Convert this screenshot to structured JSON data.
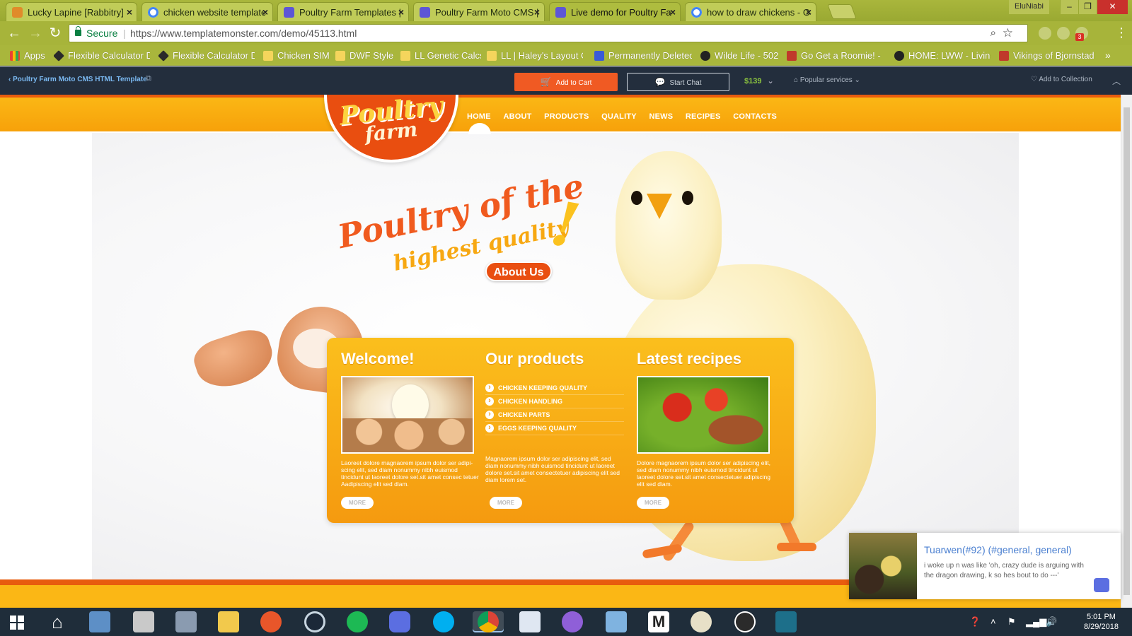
{
  "browser": {
    "tabs": [
      {
        "title": "Lucky Lapine [Rabbitry]",
        "icon": "rabbit-icon"
      },
      {
        "title": "chicken website template",
        "icon": "google-icon"
      },
      {
        "title": "Poultry Farm Templates |",
        "icon": "templatemonster-icon"
      },
      {
        "title": "Poultry Farm Moto CMS |",
        "icon": "templatemonster-icon"
      },
      {
        "title": "Live demo for Poultry Fa",
        "icon": "templatemonster-icon"
      },
      {
        "title": "how to draw chickens - G",
        "icon": "google-icon"
      }
    ],
    "active_tab": 4,
    "profile_name": "EluNiabi",
    "security_label": "Secure",
    "url": "https://www.templatemonster.com/demo/45113.html",
    "extension_badge": "3",
    "bookmarks": [
      {
        "label": "Apps",
        "icon": "apps-icon"
      },
      {
        "label": "Flexible Calculator D",
        "icon": "diamond-icon"
      },
      {
        "label": "Flexible Calculator D",
        "icon": "diamond-icon"
      },
      {
        "label": "Chicken SIM",
        "icon": "folder-icon"
      },
      {
        "label": "DWF Style",
        "icon": "folder-icon"
      },
      {
        "label": "LL Genetic Calcs",
        "icon": "folder-icon"
      },
      {
        "label": "LL | Haley's Layout C",
        "icon": "folder-icon"
      },
      {
        "label": "Permanently Deleted",
        "icon": "doc-icon"
      },
      {
        "label": "Wilde Life - 502",
        "icon": "paw-icon"
      },
      {
        "label": "Go Get a Roomie! -",
        "icon": "comic-icon"
      },
      {
        "label": "HOME: LWW - Living",
        "icon": "paw-icon"
      },
      {
        "label": "Vikings of Bjornstad",
        "icon": "shield-icon"
      }
    ]
  },
  "tm_bar": {
    "back_label": "Poultry Farm Moto CMS HTML Template",
    "add_to_cart": "Add to Cart",
    "start_chat": "Start Chat",
    "price": "$139",
    "popular_services": "Popular services",
    "add_to_collection": "Add to Collection"
  },
  "site": {
    "logo_line1": "Poultry",
    "logo_line2": "farm",
    "nav": [
      "HOME",
      "ABOUT",
      "PRODUCTS",
      "QUALITY",
      "NEWS",
      "RECIPES",
      "CONTACTS"
    ],
    "slogan_line1": "Poultry of the",
    "slogan_line2": "highest quality",
    "slogan_excl": "!",
    "about_button": "About Us",
    "columns": {
      "welcome": {
        "title": "Welcome!",
        "text": "Laoreet dolore magnaorem ipsum dolor ser adipi-scing elit, sed diam nonummy nibh euismod tincidunt ut laoreet dolore set.sit amet consec tetuer Aadipiscing elit sed diam.",
        "more": "MORE"
      },
      "products": {
        "title": "Our products",
        "items": [
          "CHICKEN KEEPING QUALITY",
          "CHICKEN HANDLING",
          "CHICKEN PARTS",
          "EGGS KEEPING QUALITY"
        ],
        "text": "Magnaorem ipsum dolor ser adipiscing elit, sed diam nonummy nibh euismod tincidunt ut laoreet dolore set.sit amet consectetuer adipiscing elit sed diam lorem set.",
        "more": "MORE"
      },
      "recipes": {
        "title": "Latest recipes",
        "text": "Dolore magnaorem ipsum dolor ser adipiscing elit, sed diam nonummy nibh euismod tincidunt ut laoreet dolore set.sit amet consectetuer adipiscing elit sed diam.",
        "more": "MORE"
      }
    }
  },
  "notification": {
    "title": "Tuarwen(#92) (#general, general)",
    "body": "i woke up n was like 'oh, crazy dude is arguing with the dragon drawing, k so hes bout to do ---'"
  },
  "taskbar": {
    "time": "5:01 PM",
    "date": "8/29/2018"
  },
  "colors": {
    "accent_orange": "#f05a23",
    "header_yellow": "#fbb715",
    "browser_theme": "#a9b63c"
  }
}
